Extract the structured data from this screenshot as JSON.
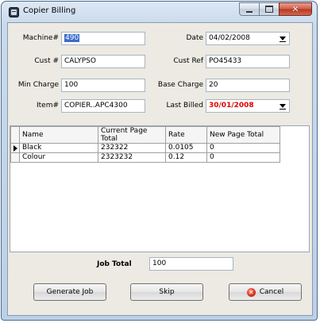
{
  "window": {
    "title": "Copier Billing",
    "controls": {
      "minimize": "–",
      "maximize": "□",
      "close": "✕"
    }
  },
  "form": {
    "machine": {
      "label": "Machine#",
      "value": "490"
    },
    "date": {
      "label": "Date",
      "value": "04/02/2008"
    },
    "cust": {
      "label": "Cust #",
      "value": "CALYPSO"
    },
    "cust_ref": {
      "label": "Cust Ref",
      "value": "PO45433"
    },
    "min_charge": {
      "label": "Min Charge",
      "value": "100"
    },
    "base_charge": {
      "label": "Base Charge",
      "value": "20"
    },
    "item": {
      "label": "Item#",
      "value": "COPIER..APC4300"
    },
    "last_billed": {
      "label": "Last Billed",
      "value": "30/01/2008"
    }
  },
  "grid": {
    "columns": [
      "Name",
      "Current Page Total",
      "Rate",
      "New Page Total"
    ],
    "rows": [
      [
        "Black",
        "232322",
        "0.0105",
        "0"
      ],
      [
        "Colour",
        "2323232",
        "0.12",
        "0"
      ]
    ]
  },
  "job_total": {
    "label": "Job Total",
    "value": "100"
  },
  "buttons": {
    "generate": "Generate Job",
    "skip": "Skip",
    "cancel": "Cancel"
  },
  "colors": {
    "accent_red": "#e00000",
    "selection": "#3a6cc8"
  }
}
